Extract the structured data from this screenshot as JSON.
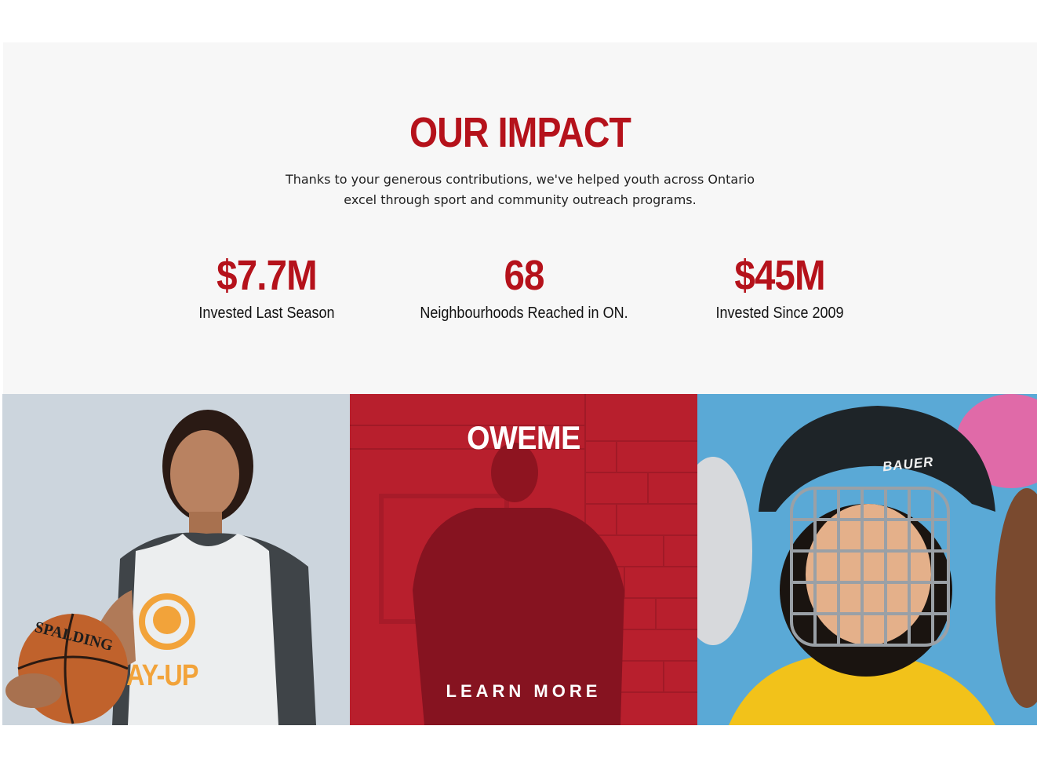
{
  "impact": {
    "title": "OUR IMPACT",
    "description_lines": [
      "Thanks to your generous contributions, we've helped youth across Ontario",
      "excel through sport and community outreach programs."
    ],
    "stats": [
      {
        "value": "$7.7M",
        "label": "Invested Last Season"
      },
      {
        "value": "68",
        "label": "Neighbourhoods Reached in ON."
      },
      {
        "value": "$45M",
        "label": "Invested Since 2009"
      }
    ]
  },
  "tiles": [
    {
      "name": "basketball-photo",
      "jersey_text": "AY-UP",
      "ball_text": "SPALDING"
    },
    {
      "name": "oweme-feature",
      "title": "OWEME",
      "cta": "LEARN MORE"
    },
    {
      "name": "hockey-photo",
      "helmet_text": "BAUER"
    }
  ],
  "colors": {
    "accent": "#b5121b",
    "section_bg": "#f7f7f7",
    "overlay_red": "#b81f2d"
  }
}
